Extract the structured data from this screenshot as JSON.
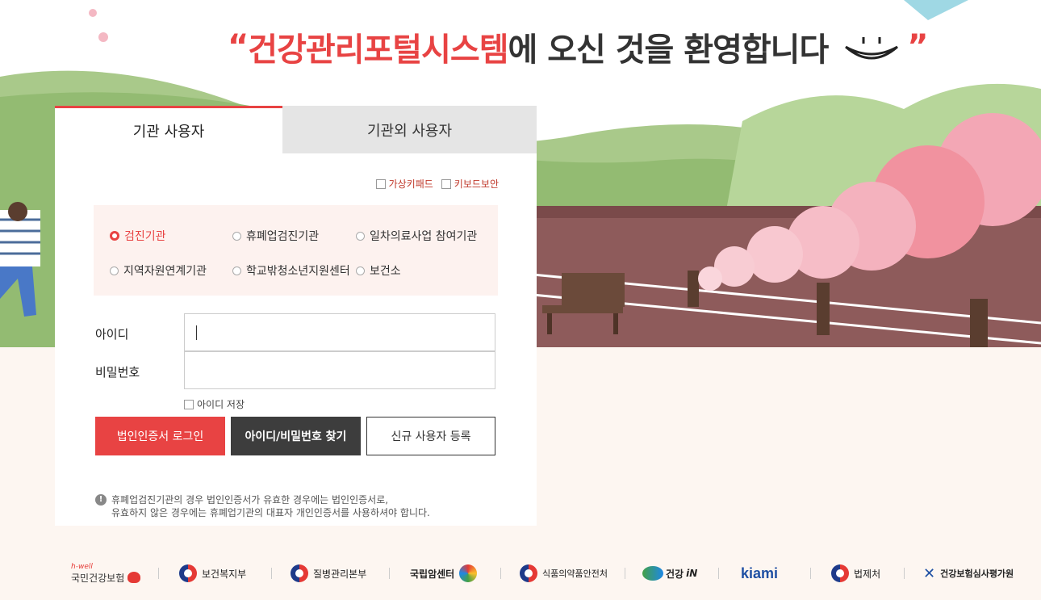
{
  "headline": {
    "quote_open": "“",
    "highlight": "건강관리포털시스템",
    "rest": "에 오신 것을 환영합니다",
    "quote_close": "”"
  },
  "tabs": [
    {
      "label": "기관 사용자",
      "active": true
    },
    {
      "label": "기관외 사용자",
      "active": false
    }
  ],
  "security": {
    "virtual_keypad": "가상키패드",
    "keyboard_security": "키보드보안"
  },
  "org_types": [
    {
      "label": "검진기관",
      "selected": true
    },
    {
      "label": "휴폐업검진기관",
      "selected": false
    },
    {
      "label": "일차의료사업 참여기관",
      "selected": false
    },
    {
      "label": "지역자원연계기관",
      "selected": false
    },
    {
      "label": "학교밖청소년지원센터",
      "selected": false
    },
    {
      "label": "보건소",
      "selected": false
    }
  ],
  "form": {
    "id_label": "아이디",
    "password_label": "비밀번호",
    "id_value": "",
    "password_value": "",
    "save_id_label": "아이디 저장"
  },
  "buttons": {
    "cert_login": "법인인증서 로그인",
    "find_account": "아이디/비밀번호 찾기",
    "register": "신규 사용자 등록"
  },
  "notice": {
    "line1": "휴폐업검진기관의 경우 법인인증서가 유효한 경우에는 법인인증서로,",
    "line2": "유효하지 않은 경우에는 휴폐업기관의 대표자 개인인증서를 사용하셔야 합니다."
  },
  "footer_logos": {
    "nhis_top": "h-well",
    "nhis": "국민건강보험",
    "mohw": "보건복지부",
    "kdca": "질병관리본부",
    "ncc": "국립암센터",
    "mfds": "식품의약품안전처",
    "health_in_prefix": "건강",
    "health_in_suffix": "iN",
    "kiami": "kiami",
    "moleg": "법제처",
    "hira": "건강보험심사평가원"
  },
  "colors": {
    "accent": "#e84343",
    "dark_button": "#3d3d3d",
    "inactive_tab": "#e5e5e5",
    "org_box_bg": "#fdf2ef"
  }
}
